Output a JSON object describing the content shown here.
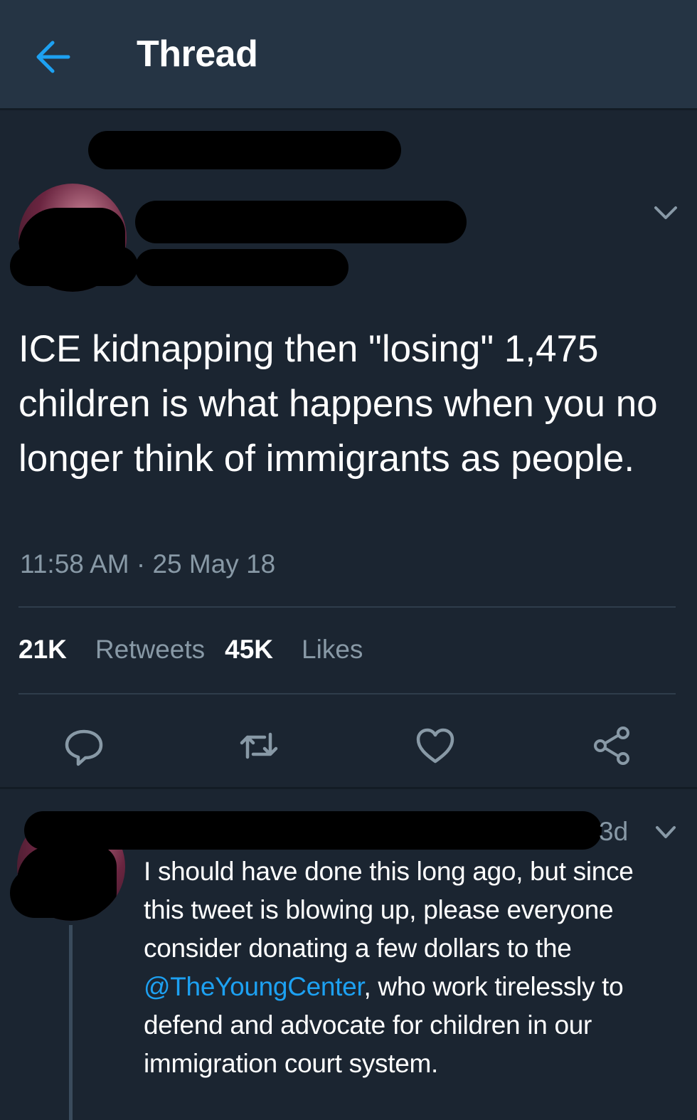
{
  "header": {
    "title": "Thread",
    "back_icon": "arrow-left-icon",
    "accent": "#1da1f2"
  },
  "tweet": {
    "text": "ICE kidnapping then \"losing\" 1,475 children is what happens when you no longer think of immigrants as people.",
    "timestamp": "11:58 AM · 25 May 18",
    "retweets_count": "21K",
    "retweets_label": "Retweets",
    "likes_count": "45K",
    "likes_label": "Likes",
    "actions": [
      "reply-icon",
      "retweet-icon",
      "heart-icon",
      "share-icon"
    ]
  },
  "reply": {
    "time": "3d",
    "text_before": "I should have done this long ago, but since this tweet is blowing up, please everyone consider donating a few dollars to the ",
    "mention": "@TheYoungCenter",
    "text_after": ", who work tirelessly to defend and advocate for children in our immigration court system."
  }
}
